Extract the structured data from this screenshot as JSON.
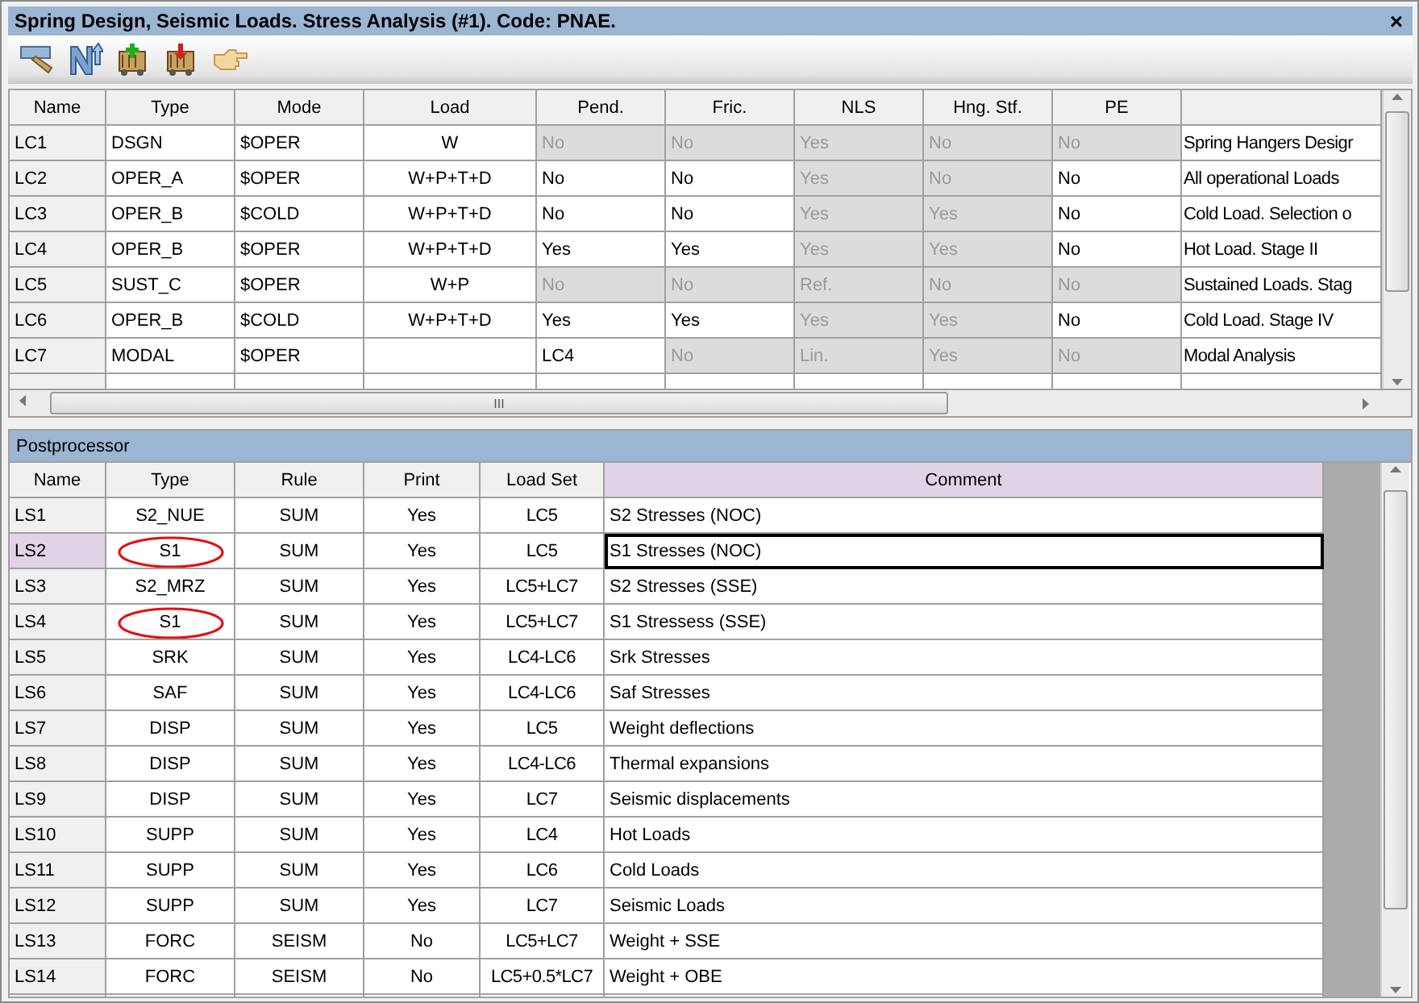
{
  "window": {
    "title": "Spring Design, Seismic Loads. Stress Analysis (#1). Code: PNAE.",
    "close": "×"
  },
  "toolbar": {
    "buttons": [
      {
        "kind": "ruler"
      },
      {
        "kind": "sort"
      },
      {
        "kind": "add"
      },
      {
        "kind": "remove"
      },
      {
        "kind": "point"
      }
    ]
  },
  "load_cases": {
    "columns": [
      "Name",
      "Type",
      "Mode",
      "Load",
      "Pend.",
      "Fric.",
      "NLS",
      "Hng. Stf.",
      "PE"
    ],
    "rows": [
      {
        "name": "LC1",
        "type": "DSGN",
        "mode": "$OPER",
        "load": "W",
        "cells": [
          {
            "text": "No",
            "disabled": true
          },
          {
            "text": "No",
            "disabled": true
          },
          {
            "text": "Yes",
            "disabled": true
          },
          {
            "text": "No",
            "disabled": true
          },
          {
            "text": "No",
            "disabled": true
          }
        ],
        "column_10": "Spring Hangers Desigr"
      },
      {
        "name": "LC2",
        "type": "OPER_A",
        "mode": "$OPER",
        "load": "W+P+T+D",
        "cells": [
          {
            "text": "No",
            "disabled": false
          },
          {
            "text": "No",
            "disabled": false
          },
          {
            "text": "Yes",
            "disabled": true
          },
          {
            "text": "No",
            "disabled": true
          },
          {
            "text": "No",
            "disabled": false
          }
        ],
        "column_10": "All operational Loads"
      },
      {
        "name": "LC3",
        "type": "OPER_B",
        "mode": "$COLD",
        "load": "W+P+T+D",
        "cells": [
          {
            "text": "No",
            "disabled": false
          },
          {
            "text": "No",
            "disabled": false
          },
          {
            "text": "Yes",
            "disabled": true
          },
          {
            "text": "Yes",
            "disabled": true
          },
          {
            "text": "No",
            "disabled": false
          }
        ],
        "column_10": "Cold Load. Selection o"
      },
      {
        "name": "LC4",
        "type": "OPER_B",
        "mode": "$OPER",
        "load": "W+P+T+D",
        "cells": [
          {
            "text": "Yes",
            "disabled": false
          },
          {
            "text": "Yes",
            "disabled": false
          },
          {
            "text": "Yes",
            "disabled": true
          },
          {
            "text": "Yes",
            "disabled": true
          },
          {
            "text": "No",
            "disabled": false
          }
        ],
        "column_10": "Hot Load. Stage II"
      },
      {
        "name": "LC5",
        "type": "SUST_C",
        "mode": "$OPER",
        "load": "W+P",
        "cells": [
          {
            "text": "No",
            "disabled": true
          },
          {
            "text": "No",
            "disabled": true
          },
          {
            "text": "Ref.",
            "disabled": true
          },
          {
            "text": "No",
            "disabled": true
          },
          {
            "text": "No",
            "disabled": true
          }
        ],
        "column_10": "Sustained Loads. Stag"
      },
      {
        "name": "LC6",
        "type": "OPER_B",
        "mode": "$COLD",
        "load": "W+P+T+D",
        "cells": [
          {
            "text": "Yes",
            "disabled": false
          },
          {
            "text": "Yes",
            "disabled": false
          },
          {
            "text": "Yes",
            "disabled": true
          },
          {
            "text": "Yes",
            "disabled": true
          },
          {
            "text": "No",
            "disabled": false
          }
        ],
        "column_10": "Cold Load. Stage IV"
      },
      {
        "name": "LC7",
        "type": "MODAL",
        "mode": "$OPER",
        "cells": [
          {
            "text": "LC4",
            "disabled": false
          },
          {
            "text": "No",
            "disabled": true
          },
          {
            "text": "Lin.",
            "disabled": true
          },
          {
            "text": "Yes",
            "disabled": true
          },
          {
            "text": "No",
            "disabled": true
          }
        ],
        "column_10": "Modal Analysis"
      }
    ],
    "scroll_thumb": "III"
  },
  "postprocessor": {
    "title": "Postprocessor",
    "columns": [
      {
        "label": "Name",
        "selected": false
      },
      {
        "label": "Type",
        "selected": false
      },
      {
        "label": "Rule",
        "selected": false
      },
      {
        "label": "Print",
        "selected": false
      },
      {
        "label": "Load Set",
        "selected": false
      },
      {
        "label": "Comment",
        "selected": true
      }
    ],
    "rows": [
      {
        "name": "LS1",
        "type": "S2_NUE",
        "rule": "SUM",
        "print": "Yes",
        "load_set": "LC5",
        "comment": "S2 Stresses (NOC)",
        "selected": false,
        "circled": false
      },
      {
        "name": "LS2",
        "type": "S1",
        "rule": "SUM",
        "print": "Yes",
        "load_set": "LC5",
        "comment": "S1 Stresses (NOC)",
        "selected": true,
        "circled": true
      },
      {
        "name": "LS3",
        "type": "S2_MRZ",
        "rule": "SUM",
        "print": "Yes",
        "load_set": "LC5+LC7",
        "comment": "S2 Stresses (SSE)",
        "selected": false,
        "circled": false
      },
      {
        "name": "LS4",
        "type": "S1",
        "rule": "SUM",
        "print": "Yes",
        "load_set": "LC5+LC7",
        "comment": "S1 Stressess (SSE)",
        "selected": false,
        "circled": true
      },
      {
        "name": "LS5",
        "type": "SRK",
        "rule": "SUM",
        "print": "Yes",
        "load_set": "LC4-LC6",
        "comment": "Srk Stresses",
        "selected": false,
        "circled": false
      },
      {
        "name": "LS6",
        "type": "SAF",
        "rule": "SUM",
        "print": "Yes",
        "load_set": "LC4-LC6",
        "comment": "Saf Stresses",
        "selected": false,
        "circled": false
      },
      {
        "name": "LS7",
        "type": "DISP",
        "rule": "SUM",
        "print": "Yes",
        "load_set": "LC5",
        "comment": "Weight deflections",
        "selected": false,
        "circled": false
      },
      {
        "name": "LS8",
        "type": "DISP",
        "rule": "SUM",
        "print": "Yes",
        "load_set": "LC4-LC6",
        "comment": "Thermal expansions",
        "selected": false,
        "circled": false
      },
      {
        "name": "LS9",
        "type": "DISP",
        "rule": "SUM",
        "print": "Yes",
        "load_set": "LC7",
        "comment": "Seismic displacements",
        "selected": false,
        "circled": false
      },
      {
        "name": "LS10",
        "type": "SUPP",
        "rule": "SUM",
        "print": "Yes",
        "load_set": "LC4",
        "comment": "Hot Loads",
        "selected": false,
        "circled": false
      },
      {
        "name": "LS11",
        "type": "SUPP",
        "rule": "SUM",
        "print": "Yes",
        "load_set": "LC6",
        "comment": "Cold Loads",
        "selected": false,
        "circled": false
      },
      {
        "name": "LS12",
        "type": "SUPP",
        "rule": "SUM",
        "print": "Yes",
        "load_set": "LC7",
        "comment": "Seismic Loads",
        "selected": false,
        "circled": false
      },
      {
        "name": "LS13",
        "type": "FORC",
        "rule": "SEISM",
        "print": "No",
        "load_set": "LC5+LC7",
        "comment": "Weight + SSE",
        "selected": false,
        "circled": false
      },
      {
        "name": "LS14",
        "type": "FORC",
        "rule": "SEISM",
        "print": "No",
        "load_set": "LC5+0.5*LC7",
        "comment": "Weight + OBE",
        "selected": false,
        "circled": false
      }
    ]
  }
}
